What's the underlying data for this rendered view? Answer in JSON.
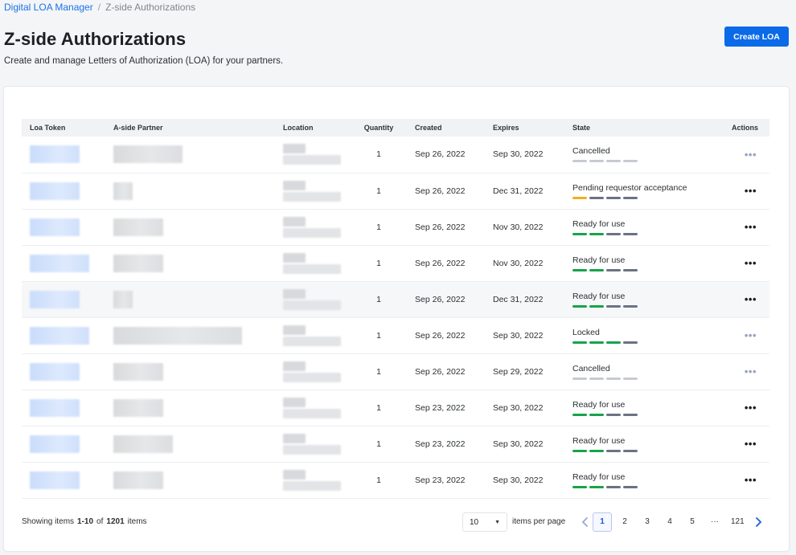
{
  "breadcrumb": {
    "root": "Digital LOA Manager",
    "separator": "/",
    "current": "Z-side Authorizations"
  },
  "header": {
    "title": "Z-side Authorizations",
    "subtitle": "Create and manage Letters of Authorization (LOA) for your partners.",
    "create_label": "Create LOA"
  },
  "table": {
    "columns": [
      "Loa Token",
      "A-side Partner",
      "Location",
      "Quantity",
      "Created",
      "Expires",
      "State",
      "Actions"
    ],
    "rows": [
      {
        "quantity": "1",
        "created": "Sep 26, 2022",
        "expires": "Sep 30, 2022",
        "state": "Cancelled",
        "bar": [
          "grey",
          "grey",
          "grey",
          "grey"
        ],
        "actions": "light"
      },
      {
        "quantity": "1",
        "created": "Sep 26, 2022",
        "expires": "Dec 31, 2022",
        "state": "Pending requestor acceptance",
        "bar": [
          "amber",
          "slate",
          "slate",
          "slate"
        ],
        "actions": "dark"
      },
      {
        "quantity": "1",
        "created": "Sep 26, 2022",
        "expires": "Nov 30, 2022",
        "state": "Ready for use",
        "bar": [
          "green",
          "green",
          "slate",
          "slate"
        ],
        "actions": "dark"
      },
      {
        "quantity": "1",
        "created": "Sep 26, 2022",
        "expires": "Nov 30, 2022",
        "state": "Ready for use",
        "bar": [
          "green",
          "green",
          "slate",
          "slate"
        ],
        "actions": "dark"
      },
      {
        "quantity": "1",
        "created": "Sep 26, 2022",
        "expires": "Dec 31, 2022",
        "state": "Ready for use",
        "bar": [
          "green",
          "green",
          "slate",
          "slate"
        ],
        "actions": "dark"
      },
      {
        "quantity": "1",
        "created": "Sep 26, 2022",
        "expires": "Sep 30, 2022",
        "state": "Locked",
        "bar": [
          "green",
          "green",
          "green",
          "slate"
        ],
        "actions": "light"
      },
      {
        "quantity": "1",
        "created": "Sep 26, 2022",
        "expires": "Sep 29, 2022",
        "state": "Cancelled",
        "bar": [
          "grey",
          "grey",
          "grey",
          "grey"
        ],
        "actions": "light"
      },
      {
        "quantity": "1",
        "created": "Sep 23, 2022",
        "expires": "Sep 30, 2022",
        "state": "Ready for use",
        "bar": [
          "green",
          "green",
          "slate",
          "slate"
        ],
        "actions": "dark"
      },
      {
        "quantity": "1",
        "created": "Sep 23, 2022",
        "expires": "Sep 30, 2022",
        "state": "Ready for use",
        "bar": [
          "green",
          "green",
          "slate",
          "slate"
        ],
        "actions": "dark"
      },
      {
        "quantity": "1",
        "created": "Sep 23, 2022",
        "expires": "Sep 30, 2022",
        "state": "Ready for use",
        "bar": [
          "green",
          "green",
          "slate",
          "slate"
        ],
        "actions": "dark"
      }
    ],
    "actions_glyph": "•••"
  },
  "footer": {
    "showing": "Showing items",
    "range": "1-10",
    "of": "of",
    "total": "1201",
    "items": "items",
    "per_page_value": "10",
    "per_page_label": "items per page",
    "pages": [
      "1",
      "2",
      "3",
      "4",
      "5",
      "···",
      "121"
    ],
    "active_page": "1"
  },
  "colors": {
    "accent": "#0a6ae8",
    "state_green": "#17a34a",
    "state_amber": "#f2b01e",
    "state_slate": "#6b7285",
    "state_grey": "#c6cad3"
  },
  "icons": {
    "prev": "chevron-left-icon",
    "next": "chevron-right-icon",
    "caret": "caret-down-icon",
    "actions": "more-horizontal-icon"
  }
}
